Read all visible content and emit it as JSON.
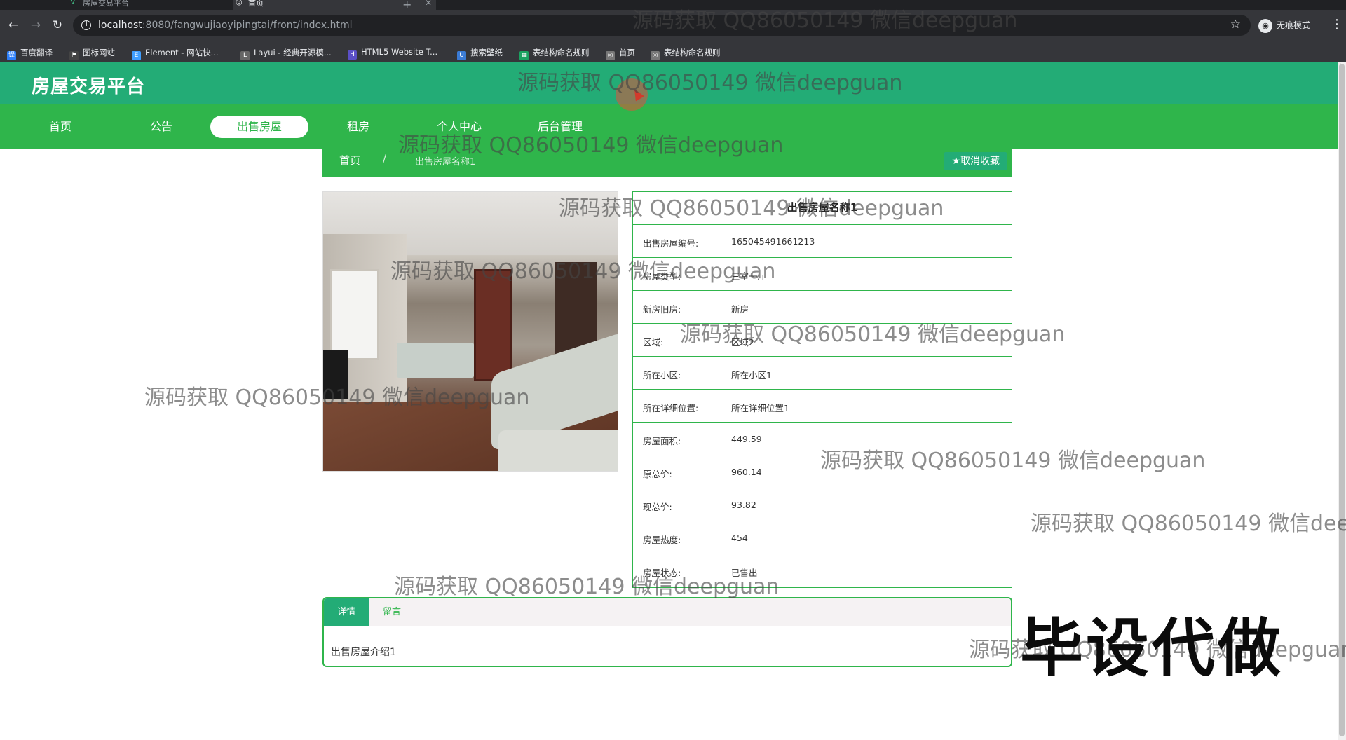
{
  "browser": {
    "tabs": [
      {
        "title": "房屋交易平台",
        "icon": "V"
      },
      {
        "title": "首页",
        "icon": "◎"
      }
    ],
    "new_tab": "+",
    "back": "←",
    "forward": "→",
    "reload": "↻",
    "url_host": "localhost",
    "url_rest": ":8080/fangwujiaoyipingtai/front/index.html",
    "star": "☆",
    "incognito_label": "无痕模式",
    "menu": "⋮",
    "bookmarks": [
      {
        "label": "百度翻译",
        "icon_color": "#2d7ff9"
      },
      {
        "label": "图标网站",
        "icon_color": "#444"
      },
      {
        "label": "Element - 网站快...",
        "icon_color": "#409eff"
      },
      {
        "label": "Layui - 经典开源模...",
        "icon_color": "#666"
      },
      {
        "label": "HTML5 Website T...",
        "icon_color": "#5b4fc7"
      },
      {
        "label": "搜索壁纸",
        "icon_color": "#3a7bd5"
      },
      {
        "label": "表结构命名规则",
        "icon_color": "#1aa260"
      },
      {
        "label": "首页",
        "icon_color": "#777"
      },
      {
        "label": "表结构命名规则",
        "icon_color": "#777"
      }
    ]
  },
  "site": {
    "title": "房屋交易平台",
    "nav": [
      "首页",
      "公告",
      "出售房屋",
      "租房",
      "个人中心",
      "后台管理"
    ],
    "nav_active": "出售房屋",
    "colors": {
      "header": "#23ac76",
      "nav": "#2fb54b"
    }
  },
  "breadcrumb": {
    "home": "首页",
    "separator": "/",
    "current": "出售房屋名称1",
    "fav_button": "★取消收藏"
  },
  "detail": {
    "name": "出售房屋名称1",
    "rows": [
      {
        "label": "出售房屋编号:",
        "value": "165045491661213"
      },
      {
        "label": "房屋类型:",
        "value": "三室一厅"
      },
      {
        "label": "新房旧房:",
        "value": "新房"
      },
      {
        "label": "区域:",
        "value": "区域2"
      },
      {
        "label": "所在小区:",
        "value": "所在小区1"
      },
      {
        "label": "所在详细位置:",
        "value": "所在详细位置1"
      },
      {
        "label": "房屋面积:",
        "value": "449.59"
      },
      {
        "label": "原总价:",
        "value": "960.14"
      },
      {
        "label": "现总价:",
        "value": "93.82"
      },
      {
        "label": "房屋热度:",
        "value": "454"
      },
      {
        "label": "房屋状态:",
        "value": "已售出"
      }
    ]
  },
  "tabs": {
    "detail_label": "详情",
    "comment_label": "留言",
    "content": "出售房屋介绍1"
  },
  "overlays": {
    "watermark": "源码获取 QQ86050149 微信deepguan",
    "stamp": "毕设代做"
  }
}
